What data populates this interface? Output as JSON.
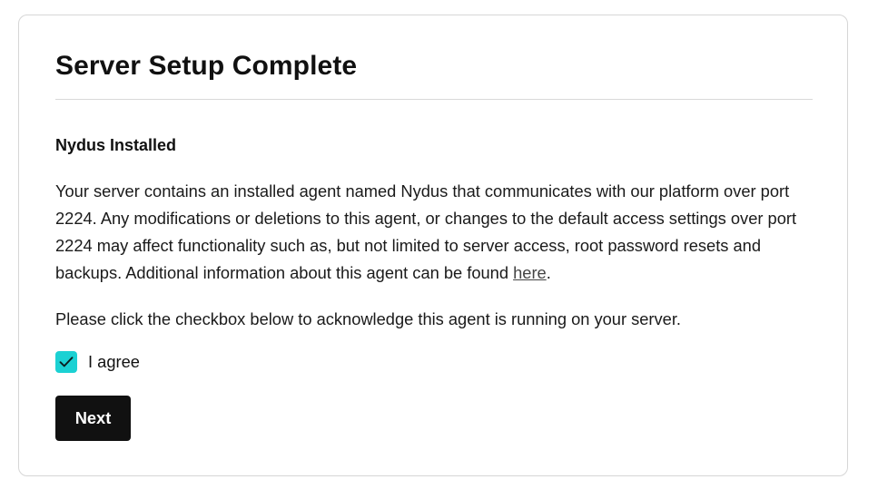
{
  "card": {
    "title": "Server Setup Complete",
    "section_heading": "Nydus Installed",
    "description": "Your server contains an installed agent named Nydus that communicates with our platform over port 2224. Any modifications or deletions to this agent, or changes to the default access settings over port 2224 may affect functionality such as, but not limited to server access, root password resets and backups. Additional information about this agent can be found ",
    "description_link": "here",
    "description_end": ".",
    "acknowledge_text": "Please click the checkbox below to acknowledge this agent is running on your server.",
    "checkbox": {
      "label": "I agree",
      "checked": true,
      "icon": "checkmark-icon",
      "color": "#1bd1d3"
    },
    "next_label": "Next"
  }
}
